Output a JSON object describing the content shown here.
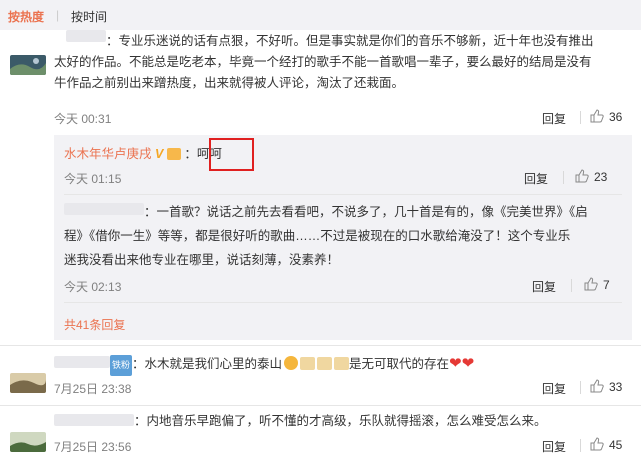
{
  "sort": {
    "hot": "按热度",
    "separator": "|",
    "time": "按时间"
  },
  "comments": [
    {
      "lines": [
        "：专业乐迷说的话有点狠，不好听。但是事实就是你们的音乐不够新，近十年也没有推出",
        "太好的作品。不能总是吃老本，毕竟一个经打的歌手不能一首歌唱一辈子，要么最好的结局是没有",
        "牛作品之前别出来蹭热度，出来就得被人评论，淘汰了还栽面。"
      ],
      "time": "今天 00:31",
      "reply": "回复",
      "likes": "36"
    },
    {
      "nick": "水木年华卢庚戌",
      "vip": "V",
      "text": "：呵呵",
      "time": "今天 01:15",
      "reply": "回复",
      "likes": "23"
    },
    {
      "lines": [
        "：一首歌？说话之前先去看看吧，不说多了，几十首是有的，像《完美世界》《启",
        "程》《借你一生》等等，都是很好听的歌曲……不过是被现在的口水歌给淹没了！这个专业乐",
        "迷我没看出来他专业在哪里，说话刻薄，没素养！"
      ],
      "time": "今天 02:13",
      "reply": "回复",
      "likes": "7"
    },
    {
      "more": "共41条回复"
    },
    {
      "badge": "铁粉",
      "text": "：水木就是我们心里的泰山",
      "text2": "是无可取代的存在",
      "time": "7月25日 23:38",
      "reply": "回复",
      "likes": "33"
    },
    {
      "text": "：内地音乐早跑偏了，听不懂的才高级，乐队就得摇滚，怎么难受怎么来。",
      "time": "7月25日 23:56",
      "reply": "回复",
      "likes": "45"
    }
  ],
  "icons": {
    "like": "thumbs-up-icon",
    "avatar": "user-avatar"
  },
  "colors": {
    "accent": "#eb7350",
    "highlight_box": "#e02020"
  }
}
